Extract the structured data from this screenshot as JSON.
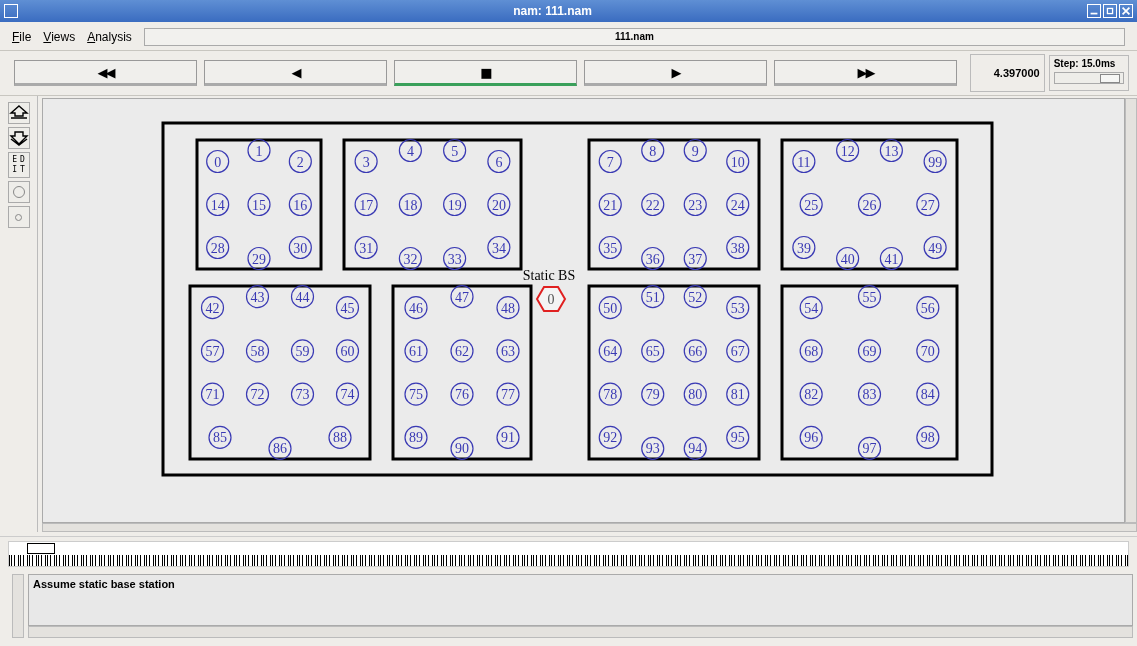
{
  "window": {
    "title": "nam: 111.nam"
  },
  "menu": [
    "File",
    "Views",
    "Analysis"
  ],
  "file_field": "111.nam",
  "controls": [
    {
      "label": "◀◀",
      "selected": false
    },
    {
      "label": "◀",
      "selected": false
    },
    {
      "label": "■",
      "selected": true
    },
    {
      "label": "▶",
      "selected": false
    },
    {
      "label": "▶▶",
      "selected": false
    }
  ],
  "time": "4.397000",
  "step": {
    "label": "Step: 15.0ms",
    "level": 0.8
  },
  "tools": [
    {
      "kind": "zoom-in"
    },
    {
      "kind": "zoom-out"
    },
    {
      "kind": "text",
      "label": "EDIT"
    },
    {
      "kind": "circle-large"
    },
    {
      "kind": "circle-small"
    }
  ],
  "base_station": {
    "label": "Static BS",
    "node": "0"
  },
  "clusters": [
    {
      "rows": [
        [
          "0",
          "1",
          "2"
        ],
        [
          "14",
          "15",
          "16"
        ],
        [
          "28",
          "29",
          "30"
        ]
      ]
    },
    {
      "rows": [
        [
          "3",
          "4",
          "5",
          "6"
        ],
        [
          "17",
          "18",
          "19",
          "20"
        ],
        [
          "31",
          "32",
          "33",
          "34"
        ]
      ]
    },
    {
      "rows": [
        [
          "7",
          "8",
          "9",
          "10"
        ],
        [
          "21",
          "22",
          "23",
          "24"
        ],
        [
          "35",
          "36",
          "37",
          "38"
        ]
      ]
    },
    {
      "rows": [
        [
          "11",
          "12",
          "13",
          "99"
        ],
        [
          "25",
          "26",
          "27"
        ],
        [
          "39",
          "40",
          "41",
          "49"
        ]
      ]
    },
    {
      "rows": [
        [
          "42",
          "43",
          "44",
          "45"
        ],
        [
          "57",
          "58",
          "59",
          "60"
        ],
        [
          "71",
          "72",
          "73",
          "74"
        ],
        [
          "85",
          "86",
          "88"
        ]
      ]
    },
    {
      "rows": [
        [
          "46",
          "47",
          "48"
        ],
        [
          "61",
          "62",
          "63"
        ],
        [
          "75",
          "76",
          "77"
        ],
        [
          "89",
          "90",
          "91"
        ]
      ]
    },
    {
      "rows": [
        [
          "50",
          "51",
          "52",
          "53"
        ],
        [
          "64",
          "65",
          "66",
          "67"
        ],
        [
          "78",
          "79",
          "80",
          "81"
        ],
        [
          "92",
          "93",
          "94",
          "95"
        ]
      ]
    },
    {
      "rows": [
        [
          "54",
          "55",
          "56"
        ],
        [
          "68",
          "69",
          "70"
        ],
        [
          "82",
          "83",
          "84"
        ],
        [
          "96",
          "97",
          "98"
        ]
      ]
    }
  ],
  "annotation": "Assume static base station"
}
